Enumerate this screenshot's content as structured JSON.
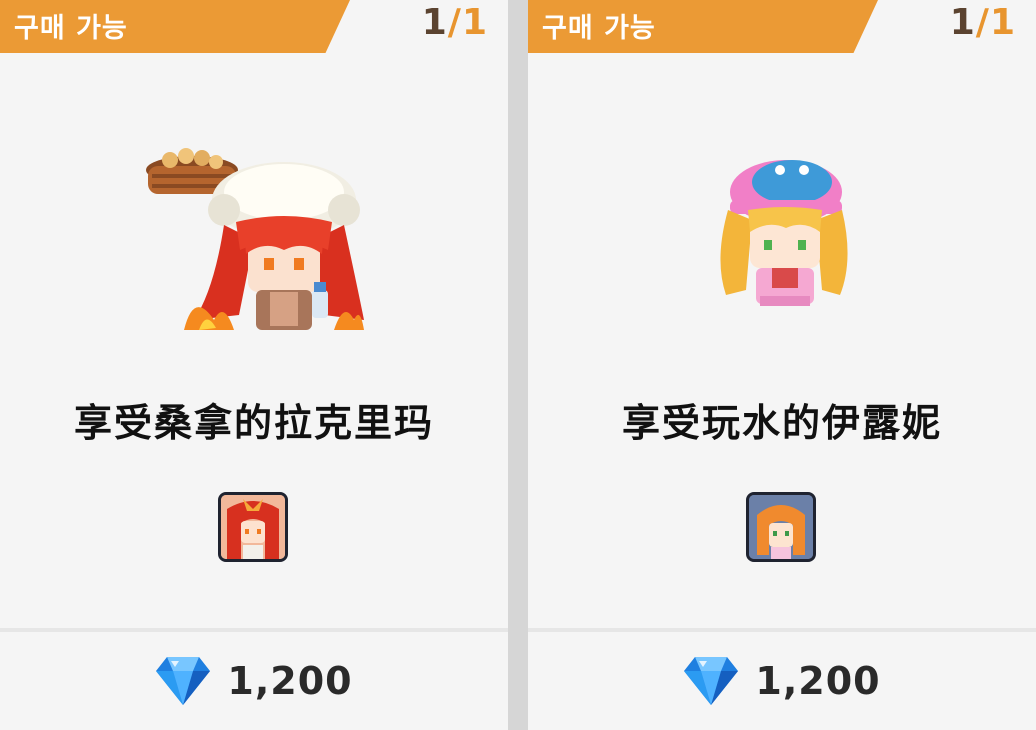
{
  "shop": {
    "cards": [
      {
        "status": "구매 가능",
        "stock_current": "1",
        "stock_separator": "/",
        "stock_max": "1",
        "name": "享受桑拿的拉克里玛",
        "price": "1,200",
        "currency_icon": "diamond-gem-icon",
        "character": "lacrima-sauna"
      },
      {
        "status": "구매 가능",
        "stock_current": "1",
        "stock_separator": "/",
        "stock_max": "1",
        "name": "享受玩水的伊露妮",
        "price": "1,200",
        "currency_icon": "diamond-gem-icon",
        "character": "iruni-water-play"
      }
    ],
    "colors": {
      "badge": "#eb9a35",
      "stock_current": "#5b4330",
      "stock_max": "#e8952f",
      "card_bg": "#f5f5f5",
      "gem": "#2d8fe6"
    }
  }
}
